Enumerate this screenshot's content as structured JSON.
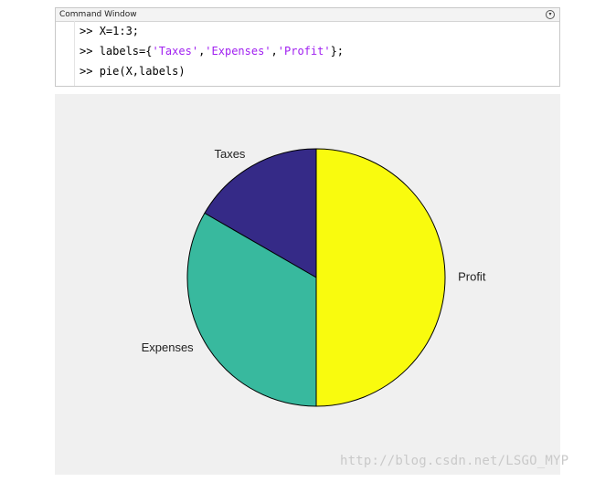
{
  "command_window": {
    "title": "Command Window",
    "menu_icon": "circle-down-arrow-icon",
    "lines": [
      [
        {
          "t": ">> ",
          "k": "prompt"
        },
        {
          "t": "X=1:3;",
          "k": "code"
        }
      ],
      [
        {
          "t": ">> ",
          "k": "prompt"
        },
        {
          "t": "labels={",
          "k": "code"
        },
        {
          "t": "'Taxes'",
          "k": "str"
        },
        {
          "t": ",",
          "k": "code"
        },
        {
          "t": "'Expenses'",
          "k": "str"
        },
        {
          "t": ",",
          "k": "code"
        },
        {
          "t": "'Profit'",
          "k": "str"
        },
        {
          "t": "};",
          "k": "code"
        }
      ],
      [
        {
          "t": ">> ",
          "k": "prompt"
        },
        {
          "t": "pie(X,labels)",
          "k": "code"
        }
      ]
    ],
    "string_color": "#a020f0"
  },
  "chart_data": {
    "type": "pie",
    "categories": [
      "Taxes",
      "Expenses",
      "Profit"
    ],
    "values": [
      1,
      2,
      3
    ],
    "colors": [
      "#352a87",
      "#38b99e",
      "#f9fb0e"
    ],
    "edge_color": "#000000"
  },
  "watermark": "http://blog.csdn.net/LSGO_MYP"
}
